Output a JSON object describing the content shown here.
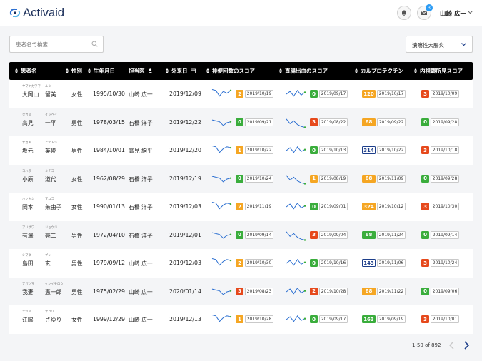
{
  "app": {
    "name": "Activaid"
  },
  "header": {
    "user_name": "山崎 広一",
    "mail_badge": "3"
  },
  "search": {
    "placeholder": "患者名で検索"
  },
  "filter": {
    "selected": "潰瘍性大腸炎"
  },
  "columns": [
    "患者名",
    "性別",
    "生年月日",
    "担当医",
    "外来日",
    "排便回数のスコア",
    "直腸出血のスコア",
    "カルプロテクチン",
    "内視鏡所見スコア"
  ],
  "rows": [
    {
      "sei_kana": "ヤマヤカワマ",
      "mei_kana": "ルミ",
      "sei": "大岡山",
      "mei": "留美",
      "gender": "女性",
      "birth": "1995/10/30",
      "doctor": "山崎 広一",
      "visit": "2019/12/09",
      "bowel": {
        "trend": [
          10,
          9,
          3,
          8,
          6,
          9
        ],
        "score": "2",
        "color": "orange",
        "date": "2019/10/19"
      },
      "bleed": {
        "trend": [
          5,
          8,
          3,
          9,
          4,
          7
        ],
        "score": "0",
        "color": "green",
        "date": "2019/09/17"
      },
      "calpro": {
        "score": "120",
        "color": "orange",
        "date": "2019/10/17"
      },
      "endo": {
        "score": "3",
        "color": "red",
        "date": "2019/10/09"
      }
    },
    {
      "sei_kana": "タカミ",
      "mei_kana": "イッペイ",
      "sei": "高見",
      "mei": "一平",
      "gender": "男性",
      "birth": "1978/03/15",
      "doctor": "石橋 洋子",
      "visit": "2019/12/22",
      "bowel": {
        "trend": [
          8,
          7,
          6,
          2,
          5,
          6
        ],
        "score": "0",
        "color": "green",
        "date": "2019/09/21"
      },
      "bleed": {
        "trend": [
          9,
          4,
          7,
          3,
          1,
          0
        ],
        "score": "3",
        "color": "red",
        "date": "2019/08/22"
      },
      "calpro": {
        "score": "68",
        "color": "orange",
        "date": "2019/09/22"
      },
      "endo": {
        "score": "0",
        "color": "green",
        "date": "2019/09/28"
      }
    },
    {
      "sei_kana": "サカキ",
      "mei_kana": "ヒデトシ",
      "sei": "坂元",
      "mei": "英俊",
      "gender": "男性",
      "birth": "1984/10/01",
      "doctor": "高見 絢平",
      "visit": "2019/12/20",
      "bowel": {
        "trend": [
          10,
          9,
          3,
          7,
          9,
          8
        ],
        "score": "1",
        "color": "orange",
        "date": "2019/10/22"
      },
      "bleed": {
        "trend": [
          5,
          8,
          3,
          9,
          4,
          6
        ],
        "score": "0",
        "color": "green",
        "date": "2019/10/13"
      },
      "calpro": {
        "score": "314",
        "color": "blue",
        "date": "2019/10/22"
      },
      "endo": {
        "score": "3",
        "color": "red",
        "date": "2019/10/18"
      }
    },
    {
      "sei_kana": "コハラ",
      "mei_kana": "ミチヨ",
      "sei": "小原",
      "mei": "道代",
      "gender": "女性",
      "birth": "1962/08/29",
      "doctor": "石橋 洋子",
      "visit": "2019/12/19",
      "bowel": {
        "trend": [
          8,
          7,
          6,
          2,
          5,
          6
        ],
        "score": "0",
        "color": "green",
        "date": "2019/10/24"
      },
      "bleed": {
        "trend": [
          9,
          4,
          7,
          3,
          1,
          0
        ],
        "score": "1",
        "color": "orange",
        "date": "2019/08/19"
      },
      "calpro": {
        "score": "68",
        "color": "orange",
        "date": "2019/11/09"
      },
      "endo": {
        "score": "0",
        "color": "green",
        "date": "2019/09/28"
      }
    },
    {
      "sei_kana": "ホシキシ",
      "mei_kana": "マユコ",
      "sei": "岡本",
      "mei": "茉由子",
      "gender": "女性",
      "birth": "1990/01/13",
      "doctor": "石橋 洋子",
      "visit": "2019/12/03",
      "bowel": {
        "trend": [
          10,
          9,
          3,
          7,
          9,
          8
        ],
        "score": "2",
        "color": "orange",
        "date": "2019/11/19"
      },
      "bleed": {
        "trend": [
          5,
          8,
          3,
          9,
          4,
          6
        ],
        "score": "0",
        "color": "green",
        "date": "2019/09/01"
      },
      "calpro": {
        "score": "324",
        "color": "orange",
        "date": "2019/10/12"
      },
      "endo": {
        "score": "3",
        "color": "red",
        "date": "2019/10/30"
      }
    },
    {
      "sei_kana": "アリサワ",
      "mei_kana": "リョウジ",
      "sei": "有澤",
      "mei": "亮二",
      "gender": "男性",
      "birth": "1972/04/10",
      "doctor": "石橋 洋子",
      "visit": "2019/12/01",
      "bowel": {
        "trend": [
          8,
          7,
          6,
          2,
          5,
          6
        ],
        "score": "0",
        "color": "green",
        "date": "2019/09/14"
      },
      "bleed": {
        "trend": [
          9,
          4,
          7,
          3,
          1,
          0
        ],
        "score": "3",
        "color": "red",
        "date": "2019/09/04"
      },
      "calpro": {
        "score": "68",
        "color": "green",
        "date": "2019/11/24"
      },
      "endo": {
        "score": "0",
        "color": "green",
        "date": "2019/09/14"
      }
    },
    {
      "sei_kana": "シマダ",
      "mei_kana": "ゲン",
      "sei": "島田",
      "mei": "玄",
      "gender": "男性",
      "birth": "1979/09/12",
      "doctor": "山崎 広一",
      "visit": "2019/12/03",
      "bowel": {
        "trend": [
          10,
          9,
          3,
          7,
          9,
          8
        ],
        "score": "2",
        "color": "orange",
        "date": "2019/10/30"
      },
      "bleed": {
        "trend": [
          5,
          8,
          3,
          9,
          4,
          6
        ],
        "score": "0",
        "color": "green",
        "date": "2019/10/16"
      },
      "calpro": {
        "score": "143",
        "color": "blue",
        "date": "2019/11/06"
      },
      "endo": {
        "score": "3",
        "color": "red",
        "date": "2019/10/24"
      }
    },
    {
      "sei_kana": "アガツマ",
      "mei_kana": "ケンイチロウ",
      "sei": "我妻",
      "mei": "憲一郎",
      "gender": "男性",
      "birth": "1975/02/29",
      "doctor": "山崎 広一",
      "visit": "2020/01/14",
      "bowel": {
        "trend": [
          8,
          7,
          6,
          2,
          5,
          6
        ],
        "score": "3",
        "color": "red",
        "date": "2019/08/23"
      },
      "bleed": {
        "trend": [
          5,
          8,
          3,
          9,
          4,
          6
        ],
        "score": "2",
        "color": "red",
        "date": "2019/10/28"
      },
      "calpro": {
        "score": "68",
        "color": "orange",
        "date": "2019/11/22"
      },
      "endo": {
        "score": "0",
        "color": "green",
        "date": "2019/09/06"
      }
    },
    {
      "sei_kana": "エヅミ",
      "mei_kana": "サユリ",
      "sei": "江脇",
      "mei": "さゆり",
      "gender": "女性",
      "birth": "1999/12/29",
      "doctor": "山崎 広一",
      "visit": "2019/12/13",
      "bowel": {
        "trend": [
          10,
          9,
          3,
          7,
          9,
          8
        ],
        "score": "1",
        "color": "orange",
        "date": "2019/10/28"
      },
      "bleed": {
        "trend": [
          5,
          8,
          3,
          9,
          4,
          6
        ],
        "score": "0",
        "color": "green",
        "date": "2019/09/17"
      },
      "calpro": {
        "score": "163",
        "color": "green",
        "date": "2019/09/19"
      },
      "endo": {
        "score": "3",
        "color": "red",
        "date": "2019/10/01"
      }
    }
  ],
  "pagination": {
    "range": "1-50 of 892"
  },
  "colors": {
    "accent": "#1d3e8a",
    "orange": "#f5a623",
    "red": "#e6491c",
    "green": "#3aad3c",
    "spark": "#2b6fd1"
  }
}
